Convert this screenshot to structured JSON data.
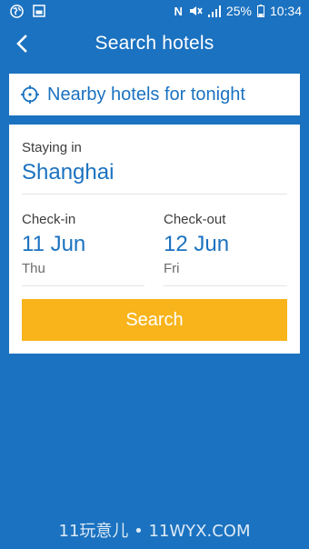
{
  "status_bar": {
    "battery_percent": "25%",
    "time": "10:34",
    "nfc_letter": "N"
  },
  "app_bar": {
    "title": "Search hotels"
  },
  "nearby": {
    "label": "Nearby hotels for tonight"
  },
  "destination": {
    "label": "Staying in",
    "value": "Shanghai"
  },
  "checkin": {
    "label": "Check-in",
    "date": "11 Jun",
    "weekday": "Thu"
  },
  "checkout": {
    "label": "Check-out",
    "date": "12 Jun",
    "weekday": "Fri"
  },
  "search_button": {
    "label": "Search"
  },
  "watermark": {
    "text": "11玩意儿 • 11WYX.COM"
  },
  "colors": {
    "brand_blue": "#1b72c0",
    "search_orange": "#f8b41a"
  }
}
